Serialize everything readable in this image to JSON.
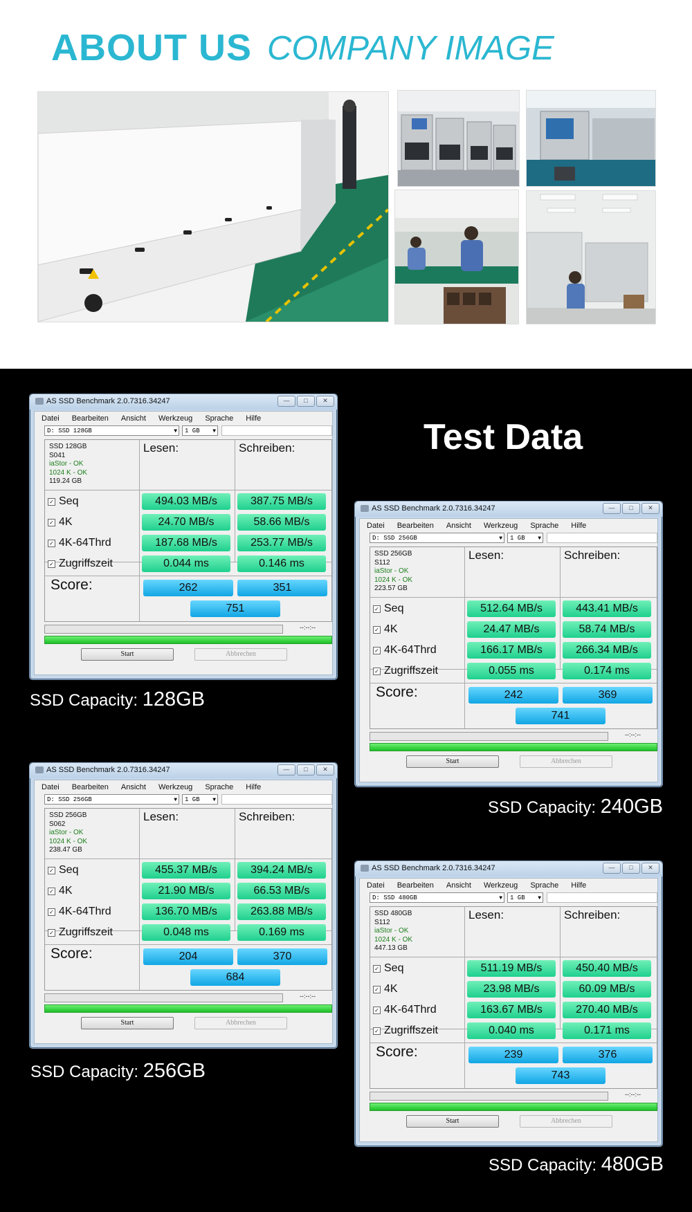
{
  "about": {
    "title": "ABOUT US",
    "subtitle": "COMPANY IMAGE"
  },
  "test_title": "Test Data",
  "labels": {
    "lesen": "Lesen:",
    "schreiben": "Schreiben:",
    "seq": "Seq",
    "k4": "4K",
    "k4_64": "4K-64Thrd",
    "access": "Zugriffszeit",
    "score": "Score:",
    "start": "Start",
    "abort": "Abbrechen",
    "time": "--:--:--",
    "size_select": "1 GB",
    "cap_prefix": "SSD Capacity:"
  },
  "window": {
    "title": "AS SSD Benchmark 2.0.7316.34247",
    "menu": [
      "Datei",
      "Bearbeiten",
      "Ansicht",
      "Werkzeug",
      "Sprache",
      "Hilfe"
    ]
  },
  "benchmarks": [
    {
      "drive": "D: SSD 128GB",
      "name": "SSD 128GB",
      "fw": "S041",
      "driver": "iaStor - OK",
      "align": "1024 K - OK",
      "size": "119.24 GB",
      "seq_r": "494.03 MB/s",
      "seq_w": "387.75 MB/s",
      "k4_r": "24.70 MB/s",
      "k4_w": "58.66 MB/s",
      "k64_r": "187.68 MB/s",
      "k64_w": "253.77 MB/s",
      "acc_r": "0.044 ms",
      "acc_w": "0.146 ms",
      "score_r": "262",
      "score_w": "351",
      "score_total": "751",
      "capacity": "128GB"
    },
    {
      "drive": "D: SSD 256GB",
      "name": "SSD 256GB",
      "fw": "S112",
      "driver": "iaStor - OK",
      "align": "1024 K - OK",
      "size": "223.57 GB",
      "seq_r": "512.64 MB/s",
      "seq_w": "443.41 MB/s",
      "k4_r": "24.47 MB/s",
      "k4_w": "58.74 MB/s",
      "k64_r": "166.17 MB/s",
      "k64_w": "266.34 MB/s",
      "acc_r": "0.055 ms",
      "acc_w": "0.174 ms",
      "score_r": "242",
      "score_w": "369",
      "score_total": "741",
      "capacity": "240GB"
    },
    {
      "drive": "D: SSD 256GB",
      "name": "SSD 256GB",
      "fw": "S062",
      "driver": "iaStor - OK",
      "align": "1024 K - OK",
      "size": "238.47 GB",
      "seq_r": "455.37 MB/s",
      "seq_w": "394.24 MB/s",
      "k4_r": "21.90 MB/s",
      "k4_w": "66.53 MB/s",
      "k64_r": "136.70 MB/s",
      "k64_w": "263.88 MB/s",
      "acc_r": "0.048 ms",
      "acc_w": "0.169 ms",
      "score_r": "204",
      "score_w": "370",
      "score_total": "684",
      "capacity": "256GB"
    },
    {
      "drive": "D: SSD 480GB",
      "name": "SSD 480GB",
      "fw": "S112",
      "driver": "iaStor - OK",
      "align": "1024 K - OK",
      "size": "447.13 GB",
      "seq_r": "511.19 MB/s",
      "seq_w": "450.40 MB/s",
      "k4_r": "23.98 MB/s",
      "k4_w": "60.09 MB/s",
      "k64_r": "163.67 MB/s",
      "k64_w": "270.40 MB/s",
      "acc_r": "0.040 ms",
      "acc_w": "0.171 ms",
      "score_r": "239",
      "score_w": "376",
      "score_total": "743",
      "capacity": "480GB"
    }
  ]
}
